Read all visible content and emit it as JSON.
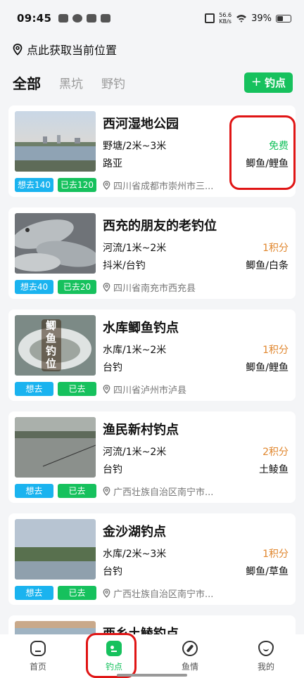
{
  "status": {
    "time": "09:45",
    "net_speed_value": "56.6",
    "net_speed_unit": "KB/s",
    "battery": "39%"
  },
  "location_text": "点此获取当前位置",
  "tabs": [
    {
      "label": "全部",
      "active": true
    },
    {
      "label": "黑坑",
      "active": false
    },
    {
      "label": "野钓",
      "active": false
    }
  ],
  "add_button_label": "钓点",
  "spots": [
    {
      "title": "西河湿地公园",
      "type_depth": "野塘/2米~3米",
      "methods": "路亚",
      "price": "免费",
      "fish": "鲫鱼/鲤鱼",
      "want": "想去140",
      "been": "已去120",
      "address": "四川省成都市崇州市三..."
    },
    {
      "title": "西充的朋友的老钓位",
      "type_depth": "河流/1米~2米",
      "methods": "抖米/台钓",
      "price": "1积分",
      "fish": "鲫鱼/白条",
      "want": "想去40",
      "been": "已去20",
      "address": "四川省南充市西充县"
    },
    {
      "title": "水库鲫鱼钓点",
      "type_depth": "水库/1米~2米",
      "methods": "台钓",
      "price": "1积分",
      "fish": "鲫鱼/鲤鱼",
      "want": "想去",
      "been": "已去",
      "address": "四川省泸州市泸县",
      "thumb_text": "鲫鱼钓位"
    },
    {
      "title": "渔民新村钓点",
      "type_depth": "河流/1米~2米",
      "methods": "台钓",
      "price": "2积分",
      "fish": "土鲮鱼",
      "want": "想去",
      "been": "已去",
      "address": "广西壮族自治区南宁市..."
    },
    {
      "title": "金沙湖钓点",
      "type_depth": "水库/2米~3米",
      "methods": "台钓",
      "price": "1积分",
      "fish": "鲫鱼/草鱼",
      "want": "想去",
      "been": "已去",
      "address": "广西壮族自治区南宁市..."
    },
    {
      "title": "西乡土鲮钓点"
    }
  ],
  "bottom_nav": [
    {
      "label": "首页",
      "icon": "home-icon"
    },
    {
      "label": "钓点",
      "icon": "spot-icon",
      "active": true
    },
    {
      "label": "鱼情",
      "icon": "compass-icon"
    },
    {
      "label": "我的",
      "icon": "profile-icon"
    }
  ],
  "colors": {
    "accent_green": "#16c15d",
    "tag_blue": "#1ab3ef",
    "price_orange": "#e0862d",
    "annotation_red": "#e01515"
  }
}
